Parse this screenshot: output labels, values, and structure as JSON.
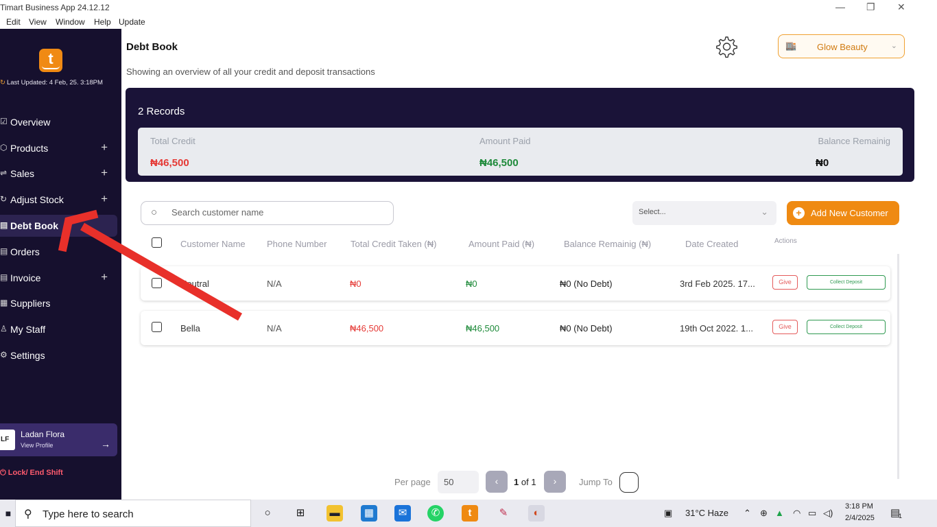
{
  "window": {
    "title": "Timart Business App 24.12.12",
    "menu": [
      "Edit",
      "View",
      "Window",
      "Help",
      "Update"
    ]
  },
  "sidebar": {
    "logo_letter": "t",
    "last_updated": "Last Updated: 4 Feb, 25. 3:18PM",
    "items": [
      {
        "label": "Overview",
        "icon": "overview-icon",
        "expandable": false
      },
      {
        "label": "Products",
        "icon": "box-icon",
        "expandable": true
      },
      {
        "label": "Sales",
        "icon": "sales-icon",
        "expandable": true
      },
      {
        "label": "Adjust Stock",
        "icon": "adjust-icon",
        "expandable": true
      },
      {
        "label": "Debt Book",
        "icon": "book-icon",
        "expandable": false,
        "active": true
      },
      {
        "label": "Orders",
        "icon": "orders-icon",
        "expandable": false
      },
      {
        "label": "Invoice",
        "icon": "invoice-icon",
        "expandable": true
      },
      {
        "label": "Suppliers",
        "icon": "suppliers-icon",
        "expandable": false
      },
      {
        "label": "My Staff",
        "icon": "staff-icon",
        "expandable": false
      },
      {
        "label": "Settings",
        "icon": "settings-icon",
        "expandable": false
      }
    ],
    "plus_symbol": "+",
    "profile": {
      "initials": "LF",
      "name": "Ladan Flora",
      "link": "View Profile",
      "arrow": "→"
    },
    "lock_label": "Lock/ End Shift"
  },
  "header": {
    "title": "Debt Book",
    "subtitle": "Showing an overview of all your credit and deposit transactions",
    "store_name": "Glow Beauty"
  },
  "summary": {
    "records": "2 Records",
    "total_credit_label": "Total Credit",
    "total_credit_value": "₦46,500",
    "amount_paid_label": "Amount Paid",
    "amount_paid_value": "₦46,500",
    "balance_label": "Balance Remainig",
    "balance_value": "₦0"
  },
  "toolbar": {
    "search_placeholder": "Search customer name",
    "select_placeholder": "Select...",
    "add_button": "Add New Customer"
  },
  "table": {
    "headers": [
      "Customer Name",
      "Phone Number",
      "Total Credit Taken (₦)",
      "Amount Paid (₦)",
      "Balance Remainig (₦)",
      "Date Created",
      "Actions"
    ],
    "rows": [
      {
        "name": "Neutral",
        "phone": "N/A",
        "credit": "₦0",
        "paid": "₦0",
        "balance": "₦0 (No Debt)",
        "date": "3rd Feb 2025. 17...",
        "give": "Give",
        "collect": "Collect Deposit"
      },
      {
        "name": "Bella",
        "phone": "N/A",
        "credit": "₦46,500",
        "paid": "₦46,500",
        "balance": "₦0 (No Debt)",
        "date": "19th Oct 2022. 1...",
        "give": "Give",
        "collect": "Collect Deposit"
      }
    ]
  },
  "pagination": {
    "per_page_label": "Per page",
    "per_page_value": "50",
    "current": "1",
    "of_total": "of 1",
    "jump_label": "Jump To"
  },
  "taskbar": {
    "search_text": "Type here to search",
    "weather": "31°C  Haze",
    "time": "3:18 PM",
    "date": "2/4/2025",
    "notification_count": "1"
  },
  "colors": {
    "sidebar_bg": "#16102e",
    "summary_bg": "#1a1338",
    "accent_orange": "#ef8a12",
    "credit_red": "#e53935",
    "paid_green": "#1e8a3a",
    "annotation_arrow": "#e8302a"
  }
}
